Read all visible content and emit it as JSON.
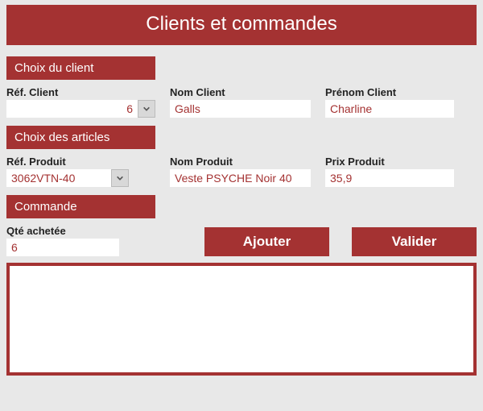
{
  "title": "Clients et commandes",
  "sections": {
    "client": "Choix du client",
    "articles": "Choix des articles",
    "commande": "Commande"
  },
  "labels": {
    "ref_client": "Réf. Client",
    "nom_client": "Nom Client",
    "prenom_client": "Prénom Client",
    "ref_produit": "Réf. Produit",
    "nom_produit": "Nom Produit",
    "prix_produit": "Prix Produit",
    "qte_achetee": "Qté achetée"
  },
  "values": {
    "ref_client": "6",
    "nom_client": "Galls",
    "prenom_client": "Charline",
    "ref_produit": "3062VTN-40",
    "nom_produit": "Veste PSYCHE Noir 40",
    "prix_produit": "35,9",
    "qte_achetee": "6"
  },
  "buttons": {
    "ajouter": "Ajouter",
    "valider": "Valider"
  }
}
